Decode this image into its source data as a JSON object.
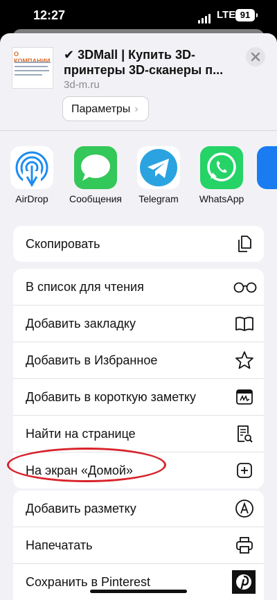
{
  "status": {
    "time": "12:27",
    "network": "LTE",
    "battery": "91"
  },
  "header": {
    "title": "✔ 3DMall | Купить 3D-принтеры 3D-сканеры п...",
    "domain": "3d-m.ru",
    "params_label": "Параметры",
    "thumbnail_text": "О КОМПАНИИ"
  },
  "apps": [
    {
      "label": "AirDrop",
      "icon": "airdrop-icon"
    },
    {
      "label": "Сообщения",
      "icon": "messages-icon"
    },
    {
      "label": "Telegram",
      "icon": "telegram-icon"
    },
    {
      "label": "WhatsApp",
      "icon": "whatsapp-icon"
    }
  ],
  "actions_group1": [
    {
      "label": "Скопировать",
      "icon": "copy-icon"
    }
  ],
  "actions_group2": [
    {
      "label": "В список для чтения",
      "icon": "glasses-icon"
    },
    {
      "label": "Добавить закладку",
      "icon": "book-icon"
    },
    {
      "label": "Добавить в Избранное",
      "icon": "star-icon"
    },
    {
      "label": "Добавить в короткую заметку",
      "icon": "quick-note-icon"
    },
    {
      "label": "Найти на странице",
      "icon": "find-on-page-icon"
    },
    {
      "label": "На экран «Домой»",
      "icon": "add-square-icon"
    }
  ],
  "actions_group3": [
    {
      "label": "Добавить разметку",
      "icon": "markup-pen-icon"
    },
    {
      "label": "Напечатать",
      "icon": "printer-icon"
    },
    {
      "label": "Сохранить в Pinterest",
      "icon": "pinterest-icon"
    }
  ],
  "colors": {
    "highlight_oval": "#d8222a",
    "sheet_bg": "#f2f2f6",
    "messages": "#34c759",
    "telegram": "#2aa3e0",
    "whatsapp": "#25d366",
    "airdrop": "#1e8cf0"
  }
}
